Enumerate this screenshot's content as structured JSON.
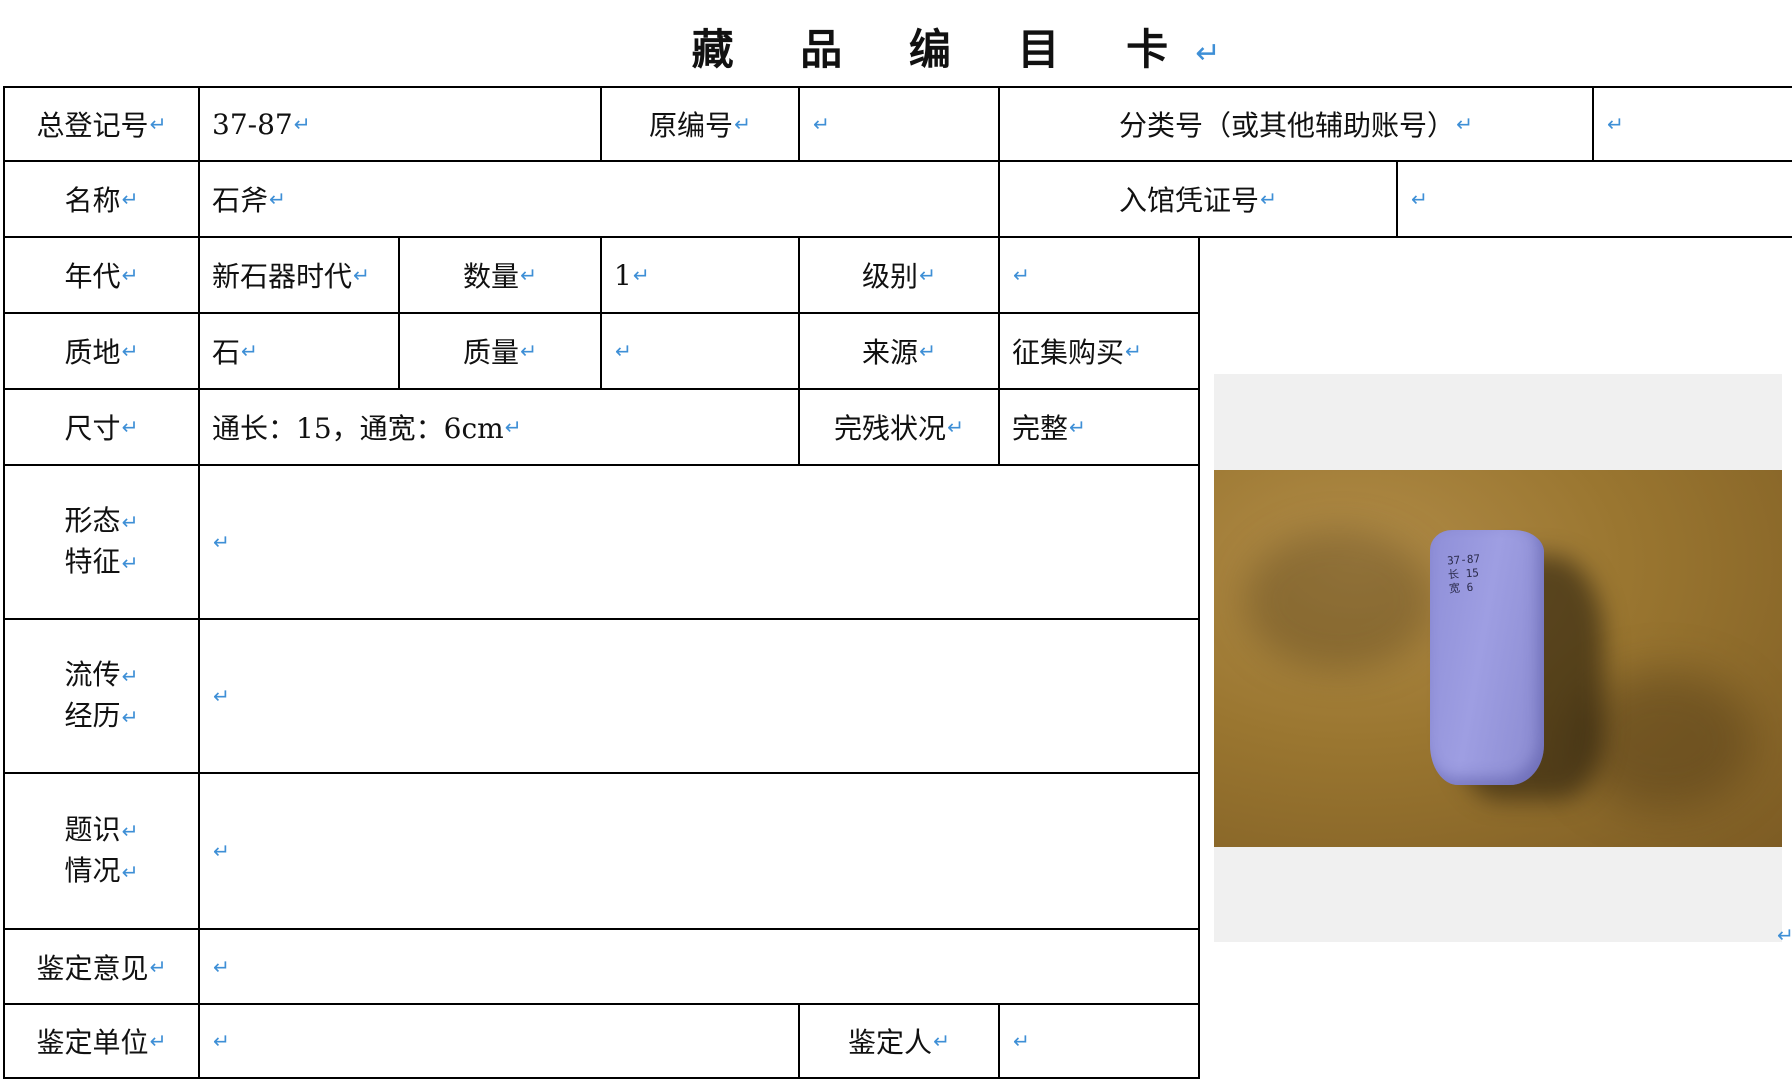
{
  "title": "藏 品 编 目 卡",
  "paragraph_mark": "↵",
  "rows": {
    "registration_number": {
      "label": "总登记号",
      "value": "37-87"
    },
    "original_number": {
      "label": "原编号",
      "value": ""
    },
    "classification_number": {
      "label": "分类号（或其他辅助账号）",
      "value": ""
    },
    "name": {
      "label": "名称",
      "value": "石斧"
    },
    "accession_voucher": {
      "label": "入馆凭证号",
      "value": ""
    },
    "era": {
      "label": "年代",
      "value": "新石器时代"
    },
    "quantity": {
      "label": "数量",
      "value": "1"
    },
    "grade": {
      "label": "级别",
      "value": ""
    },
    "material": {
      "label": "质地",
      "value": "石"
    },
    "weight": {
      "label": "质量",
      "value": ""
    },
    "source": {
      "label": "来源",
      "value": "征集购买"
    },
    "dimensions": {
      "label": "尺寸",
      "value": "通长：15，通宽：6cm"
    },
    "condition": {
      "label": "完残状况",
      "value": "完整"
    },
    "form_features": {
      "label_line1": "形态",
      "label_line2": "特征",
      "value": ""
    },
    "provenance": {
      "label_line1": "流传",
      "label_line2": "经历",
      "value": ""
    },
    "inscriptions": {
      "label_line1": "题识",
      "label_line2": "情况",
      "value": ""
    },
    "appraisal_opinion": {
      "label": "鉴定意见",
      "value": ""
    },
    "appraisal_unit": {
      "label": "鉴定单位",
      "value": ""
    },
    "appraiser": {
      "label": "鉴定人",
      "value": ""
    }
  },
  "photo": {
    "description_icon": "stone-axe-photo",
    "label_line1": "37-87",
    "label_line2": "长 15",
    "label_line3": "宽 6"
  },
  "colors": {
    "paragraph_mark": "#3e8fd6",
    "photo_background": "#f0f0f0",
    "axe": "#9a9ae0",
    "cloth": "#9a7630"
  }
}
